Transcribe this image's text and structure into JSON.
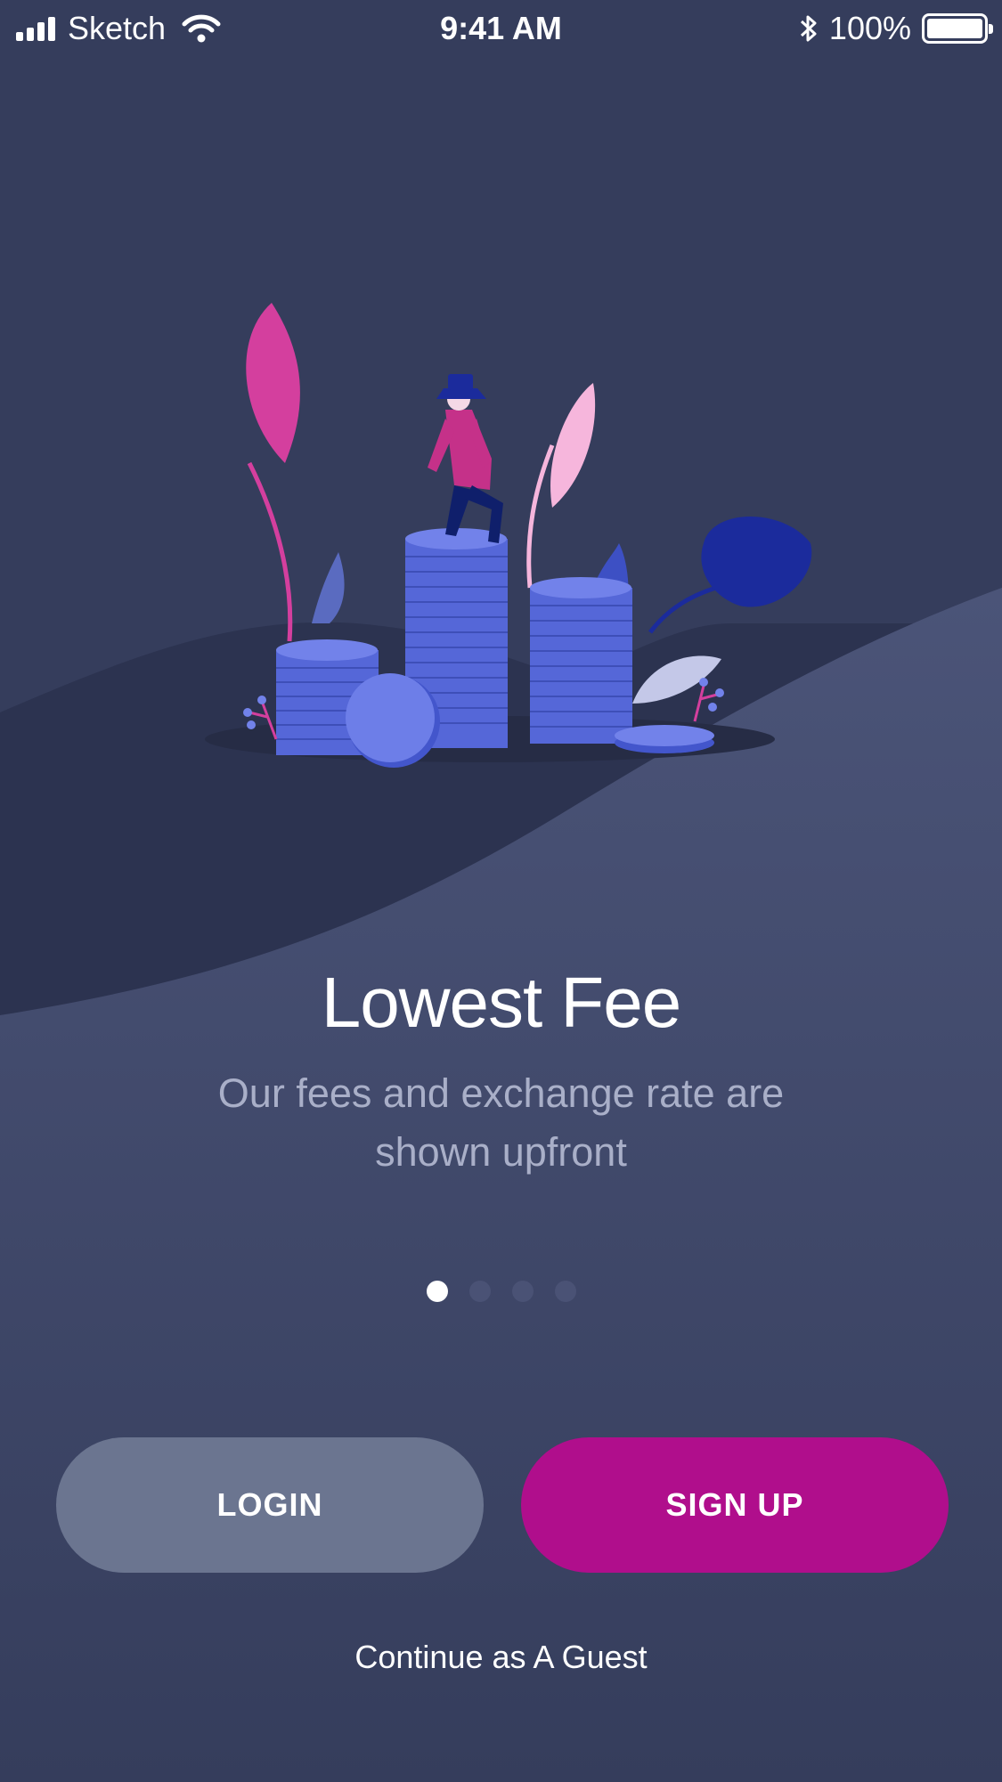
{
  "status_bar": {
    "carrier": "Sketch",
    "time": "9:41 AM",
    "battery": "100%",
    "icons": [
      "signal-icon",
      "wifi-icon",
      "bluetooth-icon",
      "battery-icon"
    ]
  },
  "onboarding": {
    "title": "Lowest Fee",
    "subtitle": "Our fees and exchange rate are shown upfront",
    "page_count": 4,
    "active_page": 1
  },
  "actions": {
    "login_label": "LOGIN",
    "signup_label": "SIGN UP",
    "guest_label": "Continue as A Guest"
  },
  "colors": {
    "background": "#353d5c",
    "login_button": "#6b7590",
    "signup_button": "#b00e8c",
    "subtitle_text": "#a9afc8"
  }
}
